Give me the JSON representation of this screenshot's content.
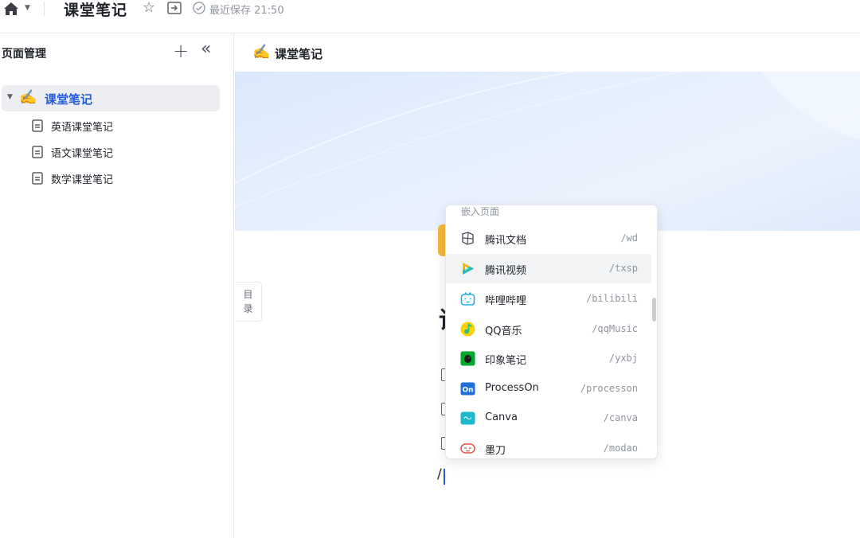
{
  "topbar": {
    "title": "课堂笔记",
    "save_status": "最近保存 21:50"
  },
  "sidebar": {
    "title": "页面管理",
    "root": {
      "emoji": "✍️",
      "label": "课堂笔记"
    },
    "children": [
      {
        "label": "英语课堂笔记"
      },
      {
        "label": "语文课堂笔记"
      },
      {
        "label": "数学课堂笔记"
      }
    ]
  },
  "main": {
    "breadcrumb": {
      "emoji": "✍️",
      "label": "课堂笔记"
    },
    "toc_label": "目\n录",
    "typed_text": "/"
  },
  "embed_menu": {
    "header": "嵌入页面",
    "items": [
      {
        "label": "腾讯文档",
        "command": "/wd",
        "icon": "tencent-docs-icon"
      },
      {
        "label": "腾讯视频",
        "command": "/txsp",
        "icon": "tencent-video-icon"
      },
      {
        "label": "哔哩哔哩",
        "command": "/bilibili",
        "icon": "bilibili-icon"
      },
      {
        "label": "QQ音乐",
        "command": "/qqMusic",
        "icon": "qq-music-icon"
      },
      {
        "label": "印象笔记",
        "command": "/yxbj",
        "icon": "evernote-icon"
      },
      {
        "label": "ProcessOn",
        "command": "/processon",
        "icon": "processon-icon"
      },
      {
        "label": "Canva",
        "command": "/canva",
        "icon": "canva-icon"
      },
      {
        "label": "墨刀",
        "command": "/modao",
        "icon": "modao-icon"
      }
    ],
    "active_index": 1
  },
  "colors": {
    "accent": "#245bdb",
    "sidebar_selected_bg": "#eceef1",
    "cover_gradient": "#dde9fa"
  }
}
